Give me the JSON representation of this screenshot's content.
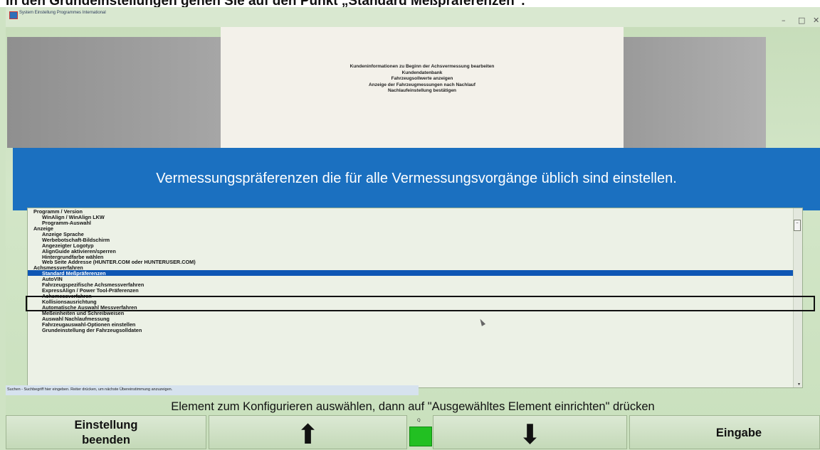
{
  "caption": "In den Grundeinstellungen gehen Sie auf den Punkt „Standard Meßpräferenzen“.",
  "window": {
    "title": "System Einstellung  Programmes International",
    "minimize": "–",
    "restore": "□",
    "close": "✕"
  },
  "info_lines": [
    "Kundeninformationen zu Beginn der Achsvermessung bearbeiten",
    "Kundendatenbank",
    "Fahrzeugsollwerte anzeigen",
    "Anzeige der Fahrzeugmessungen nach Nachlauf",
    "Nachlaufeinstellung bestätigen"
  ],
  "banner": "Vermessungspräferenzen die für alle Vermessungsvorgänge üblich sind einstellen.",
  "list_items": [
    {
      "label": "Programm / Version",
      "level": "cat",
      "selected": false
    },
    {
      "label": "WinAlign / WinAlign LKW",
      "level": "sub",
      "selected": false
    },
    {
      "label": "Programm-Auswahl",
      "level": "sub",
      "selected": false
    },
    {
      "label": "Anzeige",
      "level": "cat",
      "selected": false
    },
    {
      "label": "Anzeige Sprache",
      "level": "sub",
      "selected": false
    },
    {
      "label": "Werbebotschaft-Bildschirm",
      "level": "sub",
      "selected": false
    },
    {
      "label": "Angezeigter Logotyp",
      "level": "sub",
      "selected": false
    },
    {
      "label": "AlignGuide aktivieren/sperren",
      "level": "sub",
      "selected": false
    },
    {
      "label": "Hintergrundfarbe wählen",
      "level": "sub",
      "selected": false
    },
    {
      "label": "Web Seite Addresse (HUNTER.COM oder HUNTERUSER.COM)",
      "level": "sub",
      "selected": false
    },
    {
      "label": "Achsmessverfahren",
      "level": "cat",
      "selected": false
    },
    {
      "label": "Standard Meßpräferenzen",
      "level": "sub",
      "selected": true
    },
    {
      "label": "AutoVIN",
      "level": "sub",
      "selected": false
    },
    {
      "label": "Fahrzeugspezifische Achsmessverfahren",
      "level": "sub",
      "selected": false
    },
    {
      "label": "ExpressAlign / Power Tool-Präferenzen",
      "level": "sub",
      "selected": false
    },
    {
      "label": "Achsmessverfahren",
      "level": "sub",
      "selected": false
    },
    {
      "label": "Kollisionsausrichtung",
      "level": "sub",
      "selected": false
    },
    {
      "label": "Automatische Auswahl Messverfahren",
      "level": "sub",
      "selected": false
    },
    {
      "label": "Meßeinheiten und Schreibweisen",
      "level": "sub",
      "selected": false
    },
    {
      "label": "Auswahl Nachlaufmessung",
      "level": "sub",
      "selected": false
    },
    {
      "label": "Fahrzeugauswahl-Optionen einstellen",
      "level": "sub",
      "selected": false
    },
    {
      "label": "Grundeinstellung der Fahrzeugsolldaten",
      "level": "sub",
      "selected": false
    }
  ],
  "scroll": {
    "up": "–",
    "down": "▾"
  },
  "search_hint": "Suchen - Suchbegriff hier eingeben. Reiter drücken, um nächste Übereinstimmung anzuzeigen.",
  "instruction": "Element zum Konfigurieren auswählen, dann auf  \"Ausgewähltes Element einrichten\" drücken",
  "fkeys": {
    "f1_line1": "Einstellung",
    "f1_line2": "beenden",
    "f2_arrow": "⬆",
    "f3_arrow": "⬇",
    "f4": "Eingabe"
  },
  "indicator_label": "Q",
  "colors": {
    "banner": "#1b70c0",
    "selection": "#0e56b4",
    "indicator": "#22c022",
    "background": "#cfe3c4"
  }
}
